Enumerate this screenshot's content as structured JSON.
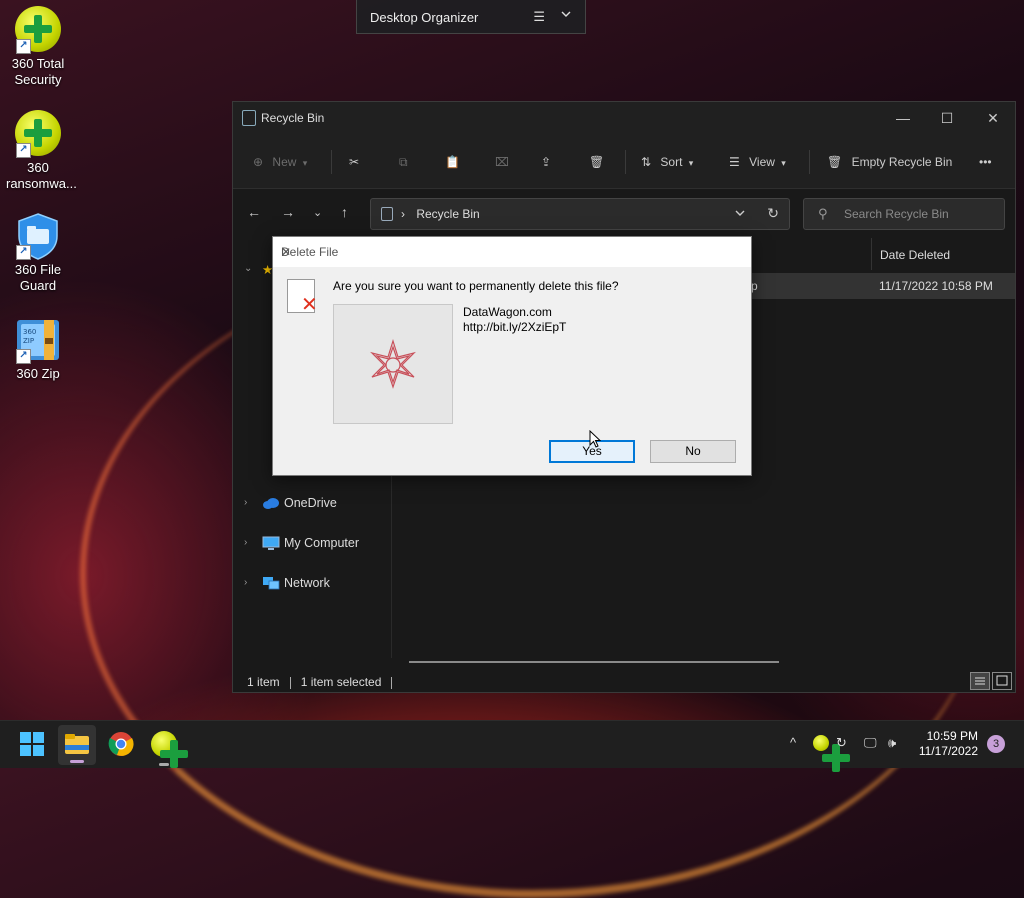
{
  "desktop": {
    "icons": [
      {
        "label": "360 Total\nSecurity",
        "line1": "360 Total",
        "line2": "Security"
      },
      {
        "line1": "360",
        "line2": "ransomwa..."
      },
      {
        "line1": "360 File",
        "line2": "Guard"
      },
      {
        "line1": "360 Zip",
        "line2": ""
      }
    ]
  },
  "organizer": {
    "title": "Desktop Organizer",
    "menu_glyph": "☰",
    "chevron": "⌄"
  },
  "explorer": {
    "title": "Recycle Bin",
    "window_buttons": {
      "minimize": "—",
      "maximize": "☐",
      "close": "✕"
    },
    "toolbar": {
      "new_label": "New",
      "sort_label": "Sort",
      "view_label": "View",
      "empty_label": "Empty Recycle Bin",
      "more_glyph": "•••"
    },
    "address": {
      "crumb_sep": "›",
      "crumb": "Recycle Bin"
    },
    "search": {
      "placeholder": "Search Recycle Bin"
    },
    "nav_items": [
      "OneDrive",
      "My Computer",
      "Network"
    ],
    "columns": {
      "date_deleted": "Date Deleted"
    },
    "row": {
      "name_fragment": "p",
      "date_deleted": "11/17/2022 10:58 PM"
    },
    "status": {
      "items": "1 item",
      "selected": "1 item selected"
    }
  },
  "dialog": {
    "title": "Delete File",
    "question": "Are you sure you want to permanently delete this file?",
    "file_name": "DataWagon.com",
    "file_url": "http://bit.ly/2XziEpT",
    "yes_label": "Yes",
    "no_label": "No",
    "close_glyph": "✕"
  },
  "taskbar": {
    "time": "10:59 PM",
    "date": "11/17/2022",
    "notification_count": "3",
    "tray_chevron": "^"
  },
  "colors": {
    "accent": "#0078d7",
    "desktop_bg": "#1b0a14",
    "explorer_bg": "#191919"
  }
}
